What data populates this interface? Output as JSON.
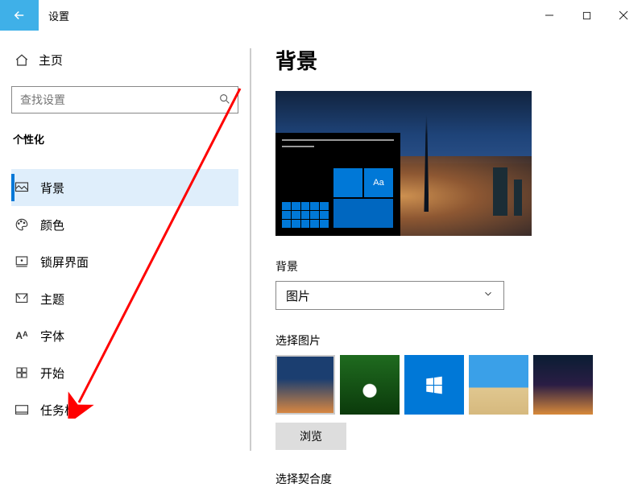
{
  "window": {
    "title": "设置"
  },
  "sidebar": {
    "home_label": "主页",
    "search_placeholder": "查找设置",
    "category": "个性化",
    "items": [
      {
        "label": "背景"
      },
      {
        "label": "颜色"
      },
      {
        "label": "锁屏界面"
      },
      {
        "label": "主题"
      },
      {
        "label": "字体"
      },
      {
        "label": "开始"
      },
      {
        "label": "任务栏"
      }
    ]
  },
  "main": {
    "title": "背景",
    "preview_aa": "Aa",
    "bg_label": "背景",
    "bg_select_value": "图片",
    "choose_label": "选择图片",
    "browse_label": "浏览",
    "fit_label": "选择契合度"
  }
}
